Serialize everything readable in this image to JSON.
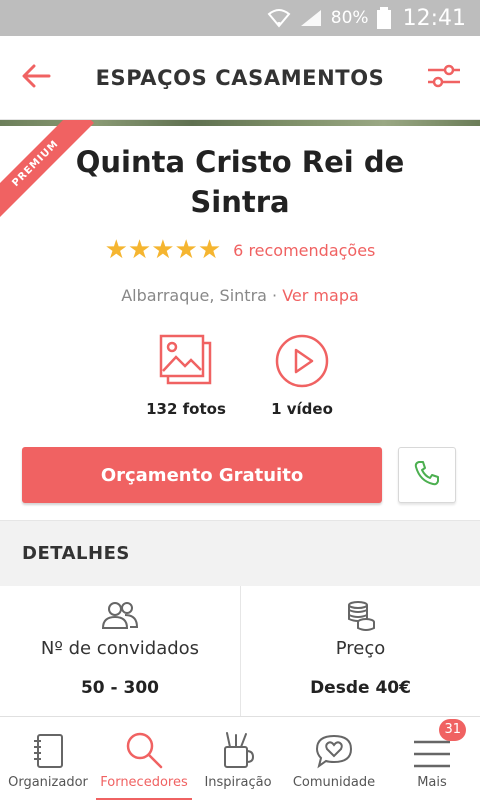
{
  "status_bar": {
    "battery": "80%",
    "time": "12:41"
  },
  "app_bar": {
    "title": "ESPAÇOS CASAMENTOS"
  },
  "premium_label": "PREMIUM",
  "venue": {
    "name": "Quinta Cristo Rei de Sintra",
    "rating_stars": 5,
    "recommendations": "6 recomendações",
    "location": "Albarraque, Sintra",
    "separator": " · ",
    "map_link": "Ver mapa",
    "photos_label": "132 fotos",
    "video_label": "1 vídeo"
  },
  "actions": {
    "quote_label": "Orçamento Gratuito"
  },
  "details": {
    "title": "DETALHES",
    "guests": {
      "label": "Nº de convidados",
      "value": "50 - 300"
    },
    "price": {
      "label": "Preço",
      "value": "Desde 40€"
    }
  },
  "bottom_nav": {
    "items": [
      {
        "label": "Organizador",
        "icon": "notebook-icon"
      },
      {
        "label": "Fornecedores",
        "icon": "search-icon",
        "active": true
      },
      {
        "label": "Inspiração",
        "icon": "cup-pencils-icon"
      },
      {
        "label": "Comunidade",
        "icon": "heart-chat-icon"
      },
      {
        "label": "Mais",
        "icon": "menu-icon",
        "badge": "31"
      }
    ]
  },
  "colors": {
    "accent": "#f06262",
    "star": "#f5b530",
    "call_green": "#4caf50"
  }
}
